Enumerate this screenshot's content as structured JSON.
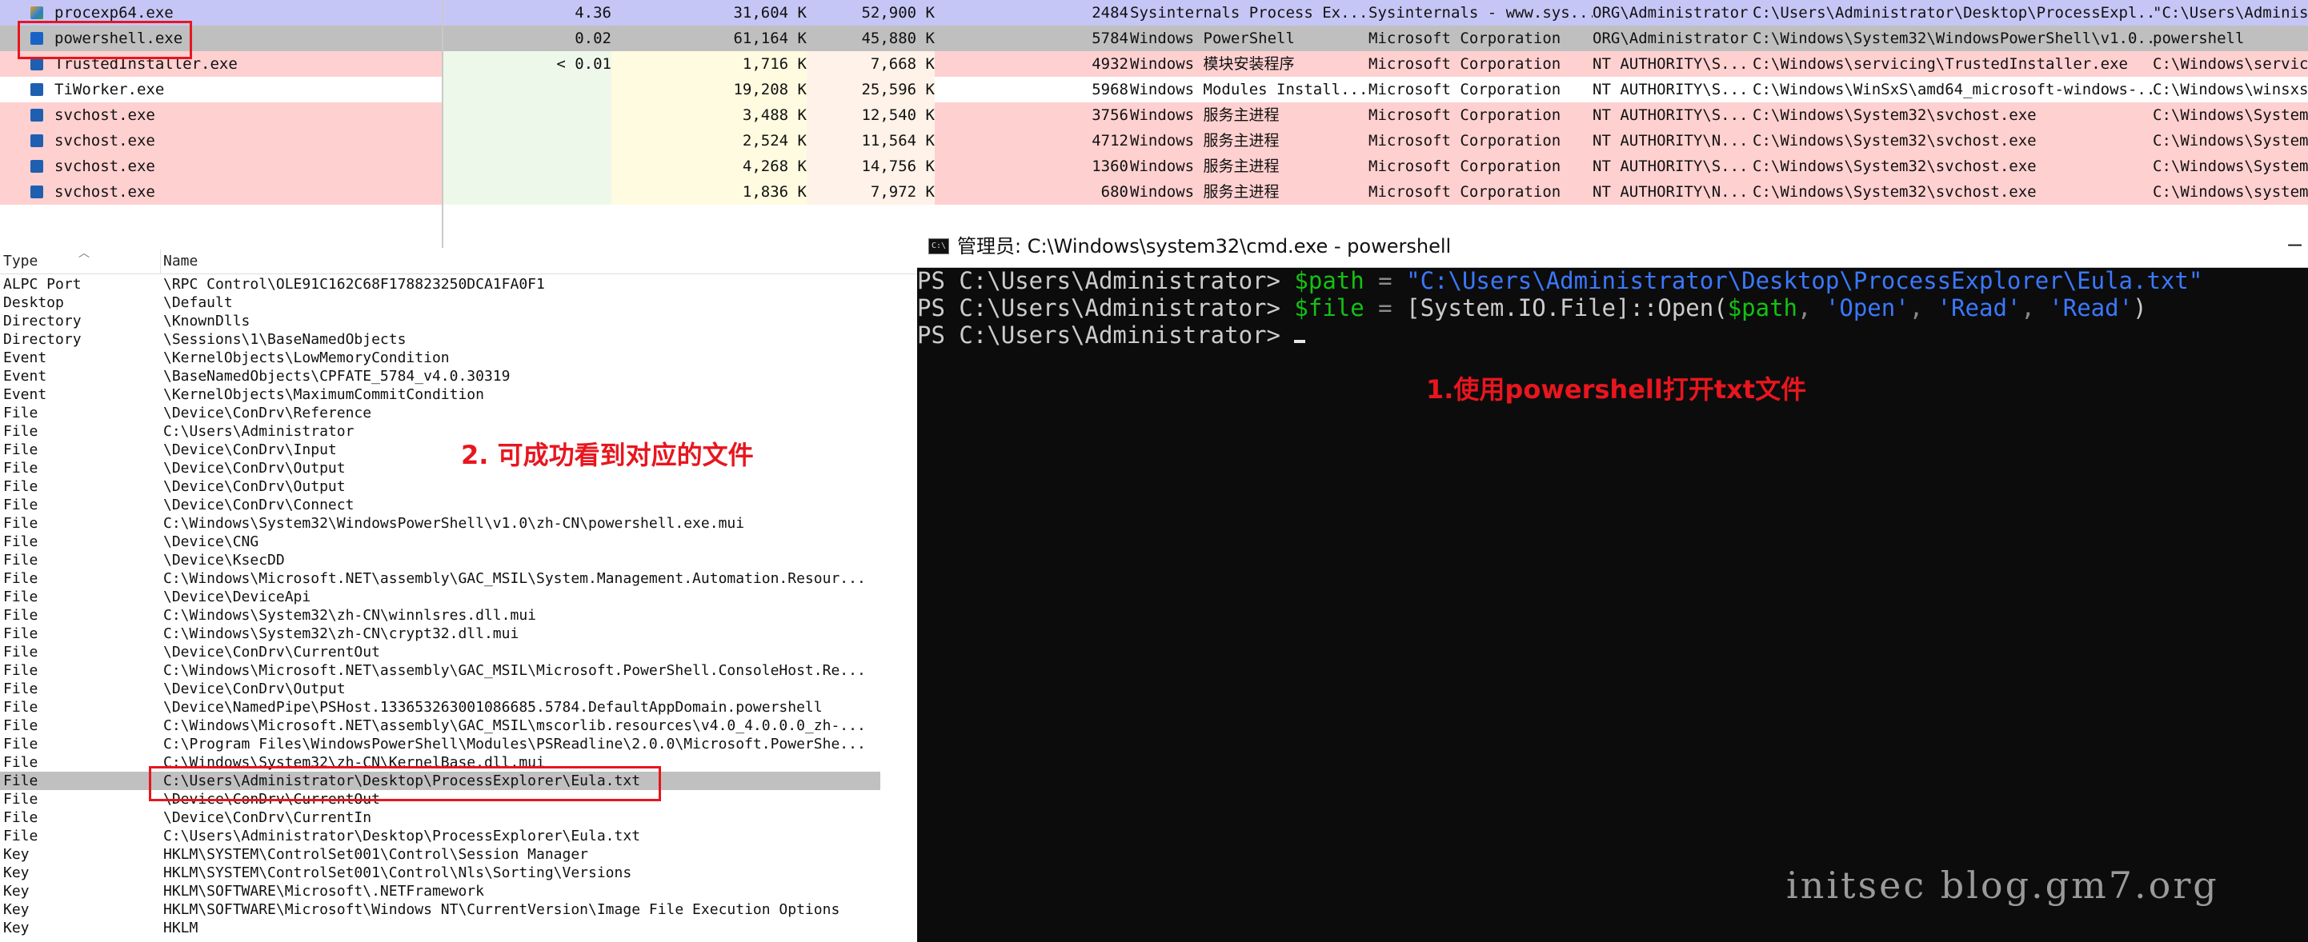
{
  "processes": [
    {
      "name": "procexp64.exe",
      "icon": "procexp-icon",
      "cpu": "4.36",
      "private_bytes": "31,604 K",
      "working_set": "52,900 K",
      "pid": "2484",
      "description": "Sysinternals Process Ex...",
      "company": "Sysinternals - www.sys...",
      "user": "ORG\\Administrator",
      "path": "C:\\Users\\Administrator\\Desktop\\ProcessExpl...",
      "command": "\"C:\\Users\\Adminis",
      "bg": "#c6c6f6",
      "selected": false
    },
    {
      "name": "powershell.exe",
      "icon": "powershell-icon",
      "cpu": "0.02",
      "private_bytes": "61,164 K",
      "working_set": "45,880 K",
      "pid": "5784",
      "description": "Windows PowerShell",
      "company": "Microsoft Corporation",
      "user": "ORG\\Administrator",
      "path": "C:\\Windows\\System32\\WindowsPowerShell\\v1.0...",
      "command": "powershell",
      "bg": "#bfbfbf",
      "selected": true
    },
    {
      "name": "TrustedInstaller.exe",
      "icon": "service-icon",
      "cpu": "< 0.01",
      "private_bytes": "1,716 K",
      "working_set": "7,668 K",
      "pid": "4932",
      "description": "Windows 模块安装程序",
      "company": "Microsoft Corporation",
      "user": "NT AUTHORITY\\S...",
      "path": "C:\\Windows\\servicing\\TrustedInstaller.exe",
      "command": "C:\\Windows\\servici",
      "bg": "#ffd0d0",
      "selected": false
    },
    {
      "name": "TiWorker.exe",
      "icon": "service-icon",
      "cpu": "",
      "private_bytes": "19,208 K",
      "working_set": "25,596 K",
      "pid": "5968",
      "description": "Windows Modules Install...",
      "company": "Microsoft Corporation",
      "user": "NT AUTHORITY\\S...",
      "path": "C:\\Windows\\WinSxS\\amd64_microsoft-windows-...",
      "command": "C:\\Windows\\winsxs\\",
      "bg": "#ffffff",
      "selected": false
    },
    {
      "name": "svchost.exe",
      "icon": "service-icon",
      "cpu": "",
      "private_bytes": "3,488 K",
      "working_set": "12,540 K",
      "pid": "3756",
      "description": "Windows 服务主进程",
      "company": "Microsoft Corporation",
      "user": "NT AUTHORITY\\S...",
      "path": "C:\\Windows\\System32\\svchost.exe",
      "command": "C:\\Windows\\System3",
      "bg": "#ffd0d0",
      "selected": false
    },
    {
      "name": "svchost.exe",
      "icon": "service-icon",
      "cpu": "",
      "private_bytes": "2,524 K",
      "working_set": "11,564 K",
      "pid": "4712",
      "description": "Windows 服务主进程",
      "company": "Microsoft Corporation",
      "user": "NT AUTHORITY\\N...",
      "path": "C:\\Windows\\System32\\svchost.exe",
      "command": "C:\\Windows\\System3",
      "bg": "#ffd0d0",
      "selected": false
    },
    {
      "name": "svchost.exe",
      "icon": "service-icon",
      "cpu": "",
      "private_bytes": "4,268 K",
      "working_set": "14,756 K",
      "pid": "1360",
      "description": "Windows 服务主进程",
      "company": "Microsoft Corporation",
      "user": "NT AUTHORITY\\S...",
      "path": "C:\\Windows\\System32\\svchost.exe",
      "command": "C:\\Windows\\System3",
      "bg": "#ffd0d0",
      "selected": false
    },
    {
      "name": "svchost.exe",
      "icon": "service-icon",
      "cpu": "",
      "private_bytes": "1,836 K",
      "working_set": "7,972 K",
      "pid": "680",
      "description": "Windows 服务主进程",
      "company": "Microsoft Corporation",
      "user": "NT AUTHORITY\\N...",
      "path": "C:\\Windows\\System32\\svchost.exe",
      "command": "C:\\Windows\\system3",
      "bg": "#ffd0d0",
      "selected": false
    }
  ],
  "handles": {
    "header": {
      "type": "Type",
      "name": "Name"
    },
    "rows": [
      {
        "type": "ALPC Port",
        "name": "\\RPC Control\\OLE91C162C68F178823250DCA1FA0F1"
      },
      {
        "type": "Desktop",
        "name": "\\Default"
      },
      {
        "type": "Directory",
        "name": "\\KnownDlls"
      },
      {
        "type": "Directory",
        "name": "\\Sessions\\1\\BaseNamedObjects"
      },
      {
        "type": "Event",
        "name": "\\KernelObjects\\LowMemoryCondition"
      },
      {
        "type": "Event",
        "name": "\\BaseNamedObjects\\CPFATE_5784_v4.0.30319"
      },
      {
        "type": "Event",
        "name": "\\KernelObjects\\MaximumCommitCondition"
      },
      {
        "type": "File",
        "name": "\\Device\\ConDrv\\Reference"
      },
      {
        "type": "File",
        "name": "C:\\Users\\Administrator"
      },
      {
        "type": "File",
        "name": "\\Device\\ConDrv\\Input"
      },
      {
        "type": "File",
        "name": "\\Device\\ConDrv\\Output"
      },
      {
        "type": "File",
        "name": "\\Device\\ConDrv\\Output"
      },
      {
        "type": "File",
        "name": "\\Device\\ConDrv\\Connect"
      },
      {
        "type": "File",
        "name": "C:\\Windows\\System32\\WindowsPowerShell\\v1.0\\zh-CN\\powershell.exe.mui"
      },
      {
        "type": "File",
        "name": "\\Device\\CNG"
      },
      {
        "type": "File",
        "name": "\\Device\\KsecDD"
      },
      {
        "type": "File",
        "name": "C:\\Windows\\Microsoft.NET\\assembly\\GAC_MSIL\\System.Management.Automation.Resour..."
      },
      {
        "type": "File",
        "name": "\\Device\\DeviceApi"
      },
      {
        "type": "File",
        "name": "C:\\Windows\\System32\\zh-CN\\winnlsres.dll.mui"
      },
      {
        "type": "File",
        "name": "C:\\Windows\\System32\\zh-CN\\crypt32.dll.mui"
      },
      {
        "type": "File",
        "name": "\\Device\\ConDrv\\CurrentOut"
      },
      {
        "type": "File",
        "name": "C:\\Windows\\Microsoft.NET\\assembly\\GAC_MSIL\\Microsoft.PowerShell.ConsoleHost.Re..."
      },
      {
        "type": "File",
        "name": "\\Device\\ConDrv\\Output"
      },
      {
        "type": "File",
        "name": "\\Device\\NamedPipe\\PSHost.133653263001086685.5784.DefaultAppDomain.powershell"
      },
      {
        "type": "File",
        "name": "C:\\Windows\\Microsoft.NET\\assembly\\GAC_MSIL\\mscorlib.resources\\v4.0_4.0.0.0_zh-..."
      },
      {
        "type": "File",
        "name": "C:\\Program Files\\WindowsPowerShell\\Modules\\PSReadline\\2.0.0\\Microsoft.PowerShe..."
      },
      {
        "type": "File",
        "name": "C:\\Windows\\System32\\zh-CN\\KernelBase.dll.mui"
      },
      {
        "type": "File",
        "name": "C:\\Users\\Administrator\\Desktop\\ProcessExplorer\\Eula.txt",
        "selected": true
      },
      {
        "type": "File",
        "name": "\\Device\\ConDrv\\CurrentOut"
      },
      {
        "type": "File",
        "name": "\\Device\\ConDrv\\CurrentIn"
      },
      {
        "type": "File",
        "name": "C:\\Users\\Administrator\\Desktop\\ProcessExplorer\\Eula.txt"
      },
      {
        "type": "Key",
        "name": "HKLM\\SYSTEM\\ControlSet001\\Control\\Session Manager"
      },
      {
        "type": "Key",
        "name": "HKLM\\SYSTEM\\ControlSet001\\Control\\Nls\\Sorting\\Versions"
      },
      {
        "type": "Key",
        "name": "HKLM\\SOFTWARE\\Microsoft\\.NETFramework"
      },
      {
        "type": "Key",
        "name": "HKLM\\SOFTWARE\\Microsoft\\Windows NT\\CurrentVersion\\Image File Execution Options"
      },
      {
        "type": "Key",
        "name": "HKLM"
      }
    ]
  },
  "powershell": {
    "title": "管理员: C:\\Windows\\system32\\cmd.exe - powershell",
    "minimize": "—",
    "prompt": "PS C:\\Users\\Administrator> ",
    "line1": {
      "var": "$path",
      "op": " = ",
      "str": "\"C:\\Users\\Administrator\\Desktop\\ProcessExplorer\\Eula.txt\""
    },
    "line2": {
      "var": "$file",
      "op": " = ",
      "type": "[System.IO.File]::Open(",
      "arg_var": "$path",
      "comma1": ", ",
      "arg1": "'Open'",
      "comma2": ", ",
      "arg2": "'Read'",
      "comma3": ", ",
      "arg3": "'Read'",
      "close": ")"
    }
  },
  "annotations": {
    "step1": "1.使用powershell打开txt文件",
    "step2": "2. 可成功看到对应的文件"
  },
  "watermark": "initsec blog.gm7.org",
  "colors": {
    "annotation": "#e8161e",
    "ps_variable": "#13c213",
    "ps_string": "#3b78ff"
  }
}
